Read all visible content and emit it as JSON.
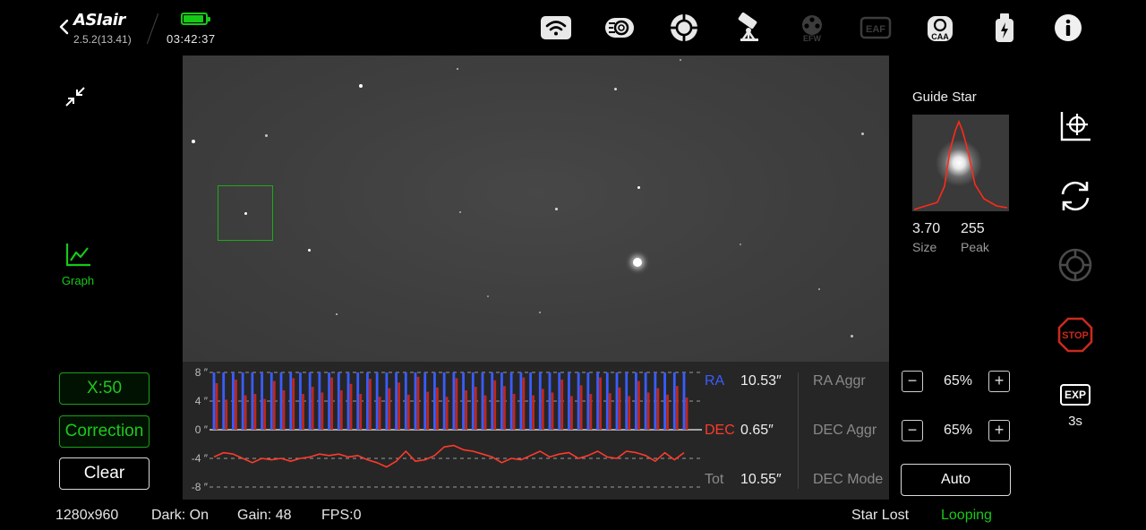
{
  "header": {
    "app_name": "ASIair",
    "version": "2.5.2(13.41)",
    "time": "03:42:37",
    "battery_level": 0.9,
    "icons": [
      "wifi-icon",
      "filter-wheel-icon",
      "mount-icon",
      "telescope-icon",
      "efw-icon",
      "eaf-icon",
      "caa-icon",
      "usb-power-icon",
      "info-icon"
    ],
    "efw_label": "EFW",
    "eaf_label": "EAF",
    "caa_label": "CAA"
  },
  "left_panel": {
    "graph_label": "Graph",
    "x_scale_label": "X:50",
    "correction_label": "Correction",
    "clear_label": "Clear"
  },
  "graph": {
    "y_ticks": [
      "8 ″",
      "4 ″",
      "0 ″",
      "-4 ″",
      "-8 ″"
    ],
    "ra_label": "RA",
    "ra_value": "10.53″",
    "dec_label": "DEC",
    "dec_value": "0.65″",
    "tot_label": "Tot",
    "tot_value": "10.55″",
    "ra_aggr_label": "RA Aggr",
    "dec_aggr_label": "DEC Aggr",
    "dec_mode_label": "DEC Mode",
    "ra_aggr_value": "65%",
    "dec_aggr_value": "65%",
    "dec_mode_value": "Auto",
    "minus": "−",
    "plus": "+",
    "colors": {
      "ra": "#3a5cff",
      "dec": "#ff3a2a"
    }
  },
  "chart_data": {
    "type": "line",
    "ylim": [
      -8,
      8
    ],
    "x": [
      1,
      2,
      3,
      4,
      5,
      6,
      7,
      8,
      9,
      10,
      11,
      12,
      13,
      14,
      15,
      16,
      17,
      18,
      19,
      20,
      21,
      22,
      23,
      24,
      25,
      26,
      27,
      28,
      29,
      30,
      31,
      32,
      33,
      34,
      35,
      36,
      37,
      38,
      39,
      40,
      41,
      42,
      43,
      44,
      45,
      46,
      47,
      48,
      49,
      50
    ],
    "series": [
      {
        "name": "RA",
        "values": [
          10.5,
          10.5,
          10.5,
          10.5,
          10.5,
          10.5,
          10.5,
          10.5,
          10.5,
          10.5,
          10.5,
          10.5,
          10.5,
          10.5,
          10.5,
          10.5,
          10.5,
          10.5,
          10.5,
          10.5,
          10.5,
          10.5,
          10.5,
          10.5,
          10.5,
          10.5,
          10.5,
          10.5,
          10.5,
          10.5,
          10.5,
          10.5,
          10.5,
          10.5,
          10.5,
          10.5,
          10.5,
          10.5,
          10.5,
          10.5,
          10.5,
          10.5,
          10.5,
          10.5,
          10.5,
          10.5,
          10.5,
          10.5,
          10.5,
          10.5
        ]
      },
      {
        "name": "DEC",
        "values": [
          6.5,
          4.2,
          7.0,
          4.8,
          5.0,
          4.3,
          6.8,
          5.5,
          7.2,
          5.0,
          6.0,
          5.2,
          7.3,
          5.5,
          6.4,
          5.0,
          7.1,
          4.6,
          5.8,
          6.6,
          4.9,
          7.4,
          5.3,
          5.9,
          4.6,
          7.2,
          5.5,
          6.0,
          4.8,
          6.9,
          6.1,
          5.0,
          7.3,
          4.8,
          5.7,
          5.2,
          7.0,
          4.7,
          6.2,
          5.0,
          7.3,
          5.1,
          5.9,
          4.7,
          6.8,
          5.2,
          5.8,
          4.9,
          6.1,
          4.5
        ]
      },
      {
        "name": "DEC-error",
        "values": [
          -3.8,
          -3.2,
          -3.4,
          -4.0,
          -4.6,
          -4.0,
          -4.2,
          -4.0,
          -4.4,
          -4.0,
          -3.8,
          -3.4,
          -3.6,
          -3.4,
          -3.8,
          -3.6,
          -4.2,
          -4.6,
          -5.2,
          -4.4,
          -3.0,
          -4.4,
          -4.2,
          -3.6,
          -2.4,
          -2.2,
          -2.8,
          -3.0,
          -3.4,
          -3.8,
          -4.6,
          -4.0,
          -4.2,
          -3.6,
          -3.0,
          -3.8,
          -3.4,
          -3.2,
          -4.0,
          -3.6,
          -3.0,
          -3.8,
          -4.0,
          -3.0,
          -3.2,
          -3.6,
          -4.4,
          -3.2,
          -4.2,
          -3.2
        ]
      }
    ]
  },
  "guide_star": {
    "title": "Guide Star",
    "size_value": "3.70",
    "size_label": "Size",
    "peak_value": "255",
    "peak_label": "Peak"
  },
  "right_icons": {
    "exp_label": "EXP",
    "exp_value": "3s",
    "stop_label": "STOP"
  },
  "status_bar": {
    "resolution": "1280x960",
    "dark": "Dark: On",
    "gain": "Gain: 48",
    "fps": "FPS:0",
    "star_state": "Star Lost",
    "loop_state": "Looping"
  }
}
